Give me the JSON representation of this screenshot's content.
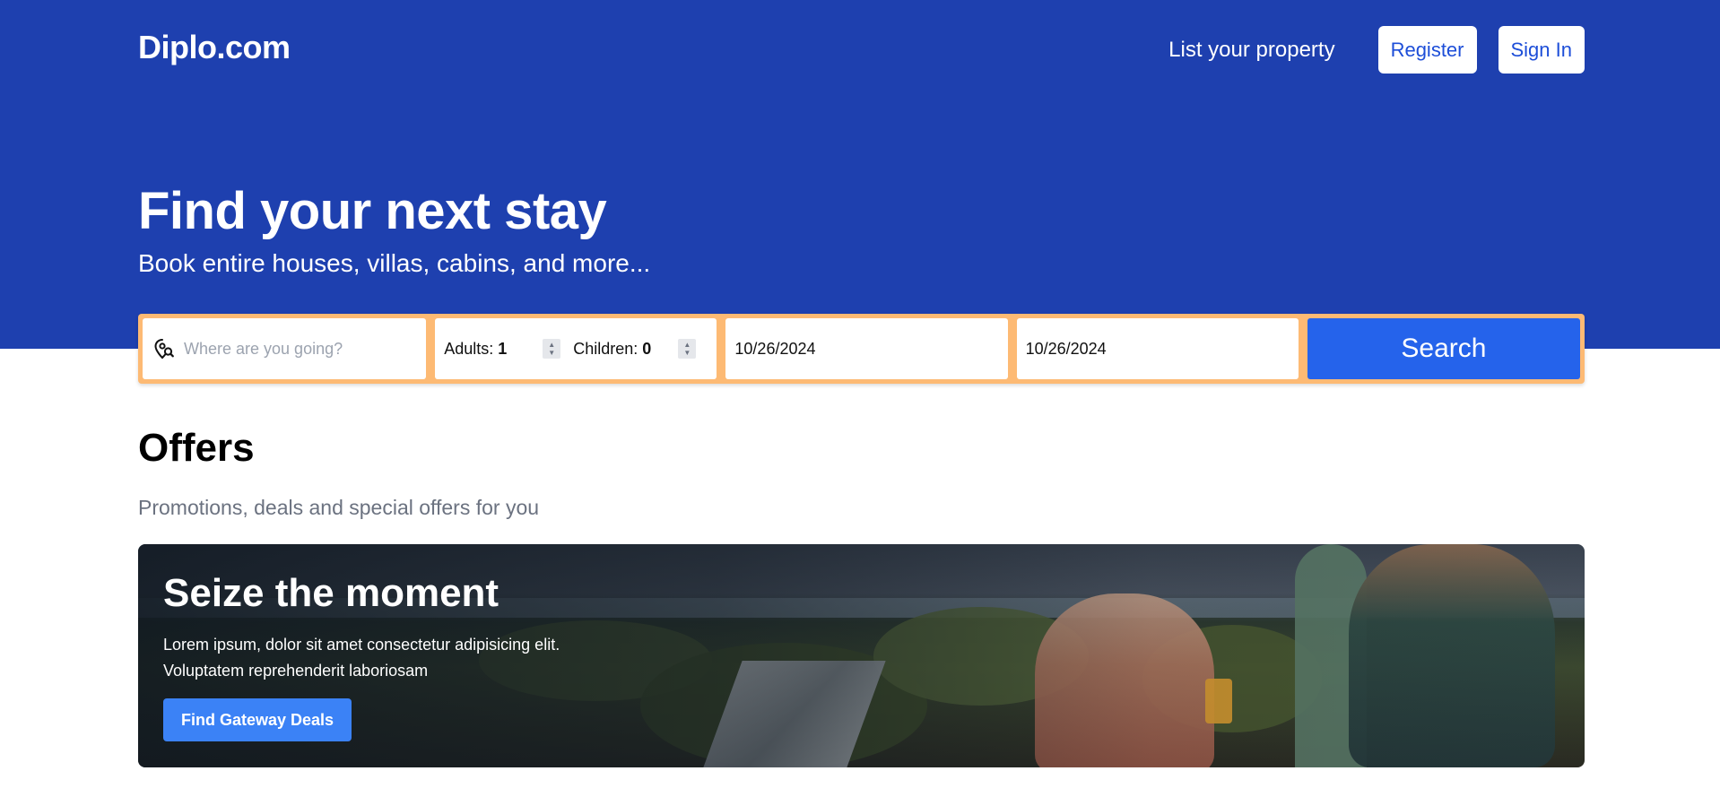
{
  "brand": {
    "logo": "Diplo.com"
  },
  "nav": {
    "list_property": "List your property",
    "register": "Register",
    "sign_in": "Sign In"
  },
  "hero": {
    "title": "Find your next stay",
    "subtitle": "Book entire houses, villas, cabins, and more..."
  },
  "search": {
    "destination_placeholder": "Where are you going?",
    "destination_icon": "location-search-icon",
    "adults_label": "Adults:",
    "adults_value": "1",
    "children_label": "Children:",
    "children_value": "0",
    "check_in": "10/26/2024",
    "check_out": "10/26/2024",
    "button": "Search"
  },
  "offers": {
    "title": "Offers",
    "subtitle": "Promotions, deals and special offers for you"
  },
  "banner": {
    "title": "Seize the moment",
    "text": "Lorem ipsum, dolor sit amet consectetur adipisicing elit. Voluptatem reprehenderit laboriosam",
    "button": "Find Gateway Deals"
  },
  "colors": {
    "primary": "#1e40af",
    "search_border": "#fdba74",
    "search_button": "#2563eb",
    "cta_button": "#3b82f6"
  }
}
